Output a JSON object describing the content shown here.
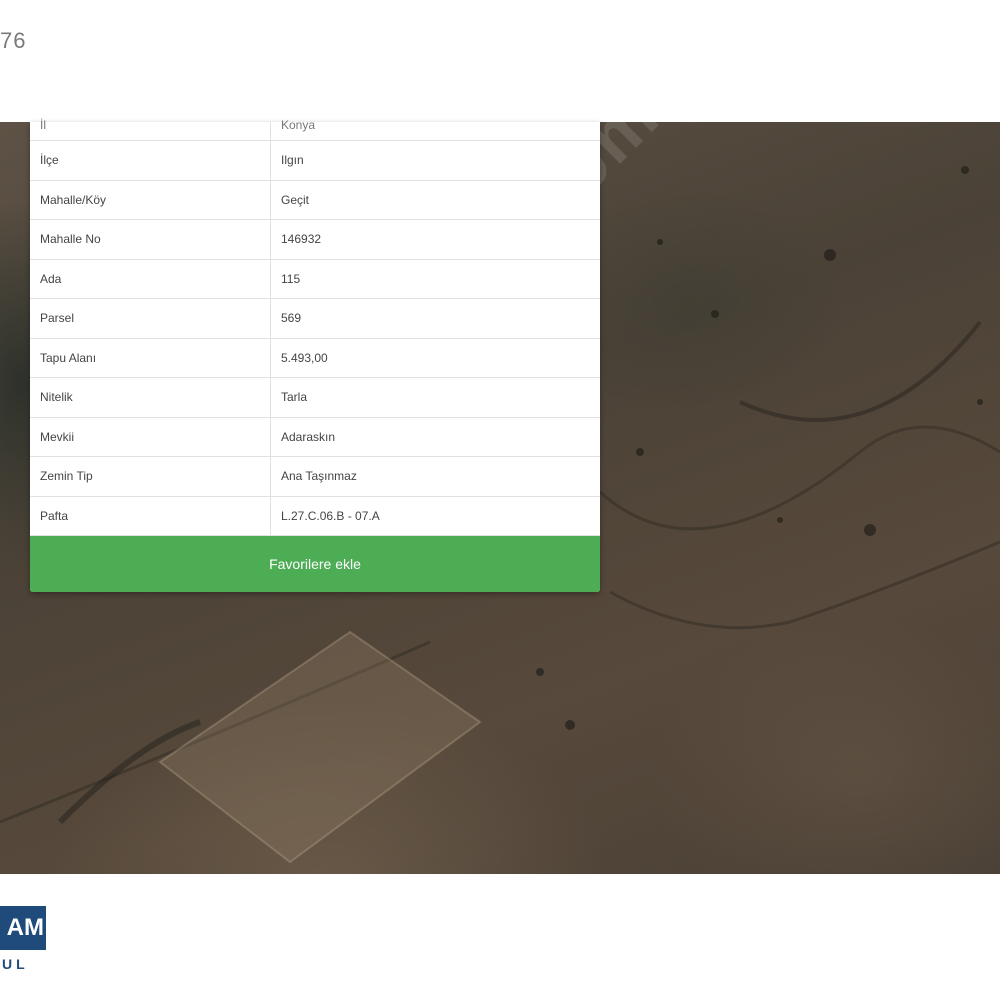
{
  "header": {
    "listing_number_partial": "76"
  },
  "info": {
    "rows": [
      {
        "label": "İl",
        "value": "Konya"
      },
      {
        "label": "İlçe",
        "value": "Ilgın"
      },
      {
        "label": "Mahalle/Köy",
        "value": "Geçit"
      },
      {
        "label": "Mahalle No",
        "value": "146932"
      },
      {
        "label": "Ada",
        "value": "115"
      },
      {
        "label": "Parsel",
        "value": "569"
      },
      {
        "label": "Tapu Alanı",
        "value": "5.493,00"
      },
      {
        "label": "Nitelik",
        "value": "Tarla"
      },
      {
        "label": "Mevkii",
        "value": "Adaraskın"
      },
      {
        "label": "Zemin Tip",
        "value": "Ana Taşınmaz"
      },
      {
        "label": "Pafta",
        "value": "L.27.C.06.B - 07.A"
      }
    ],
    "favorite_button": "Favorilere ekle"
  },
  "map": {
    "watermark": "sahibinden.com"
  },
  "logo": {
    "text": "AM",
    "subtext": "UL"
  },
  "colors": {
    "button": "#4cad55",
    "logo": "#1e4b7a"
  }
}
